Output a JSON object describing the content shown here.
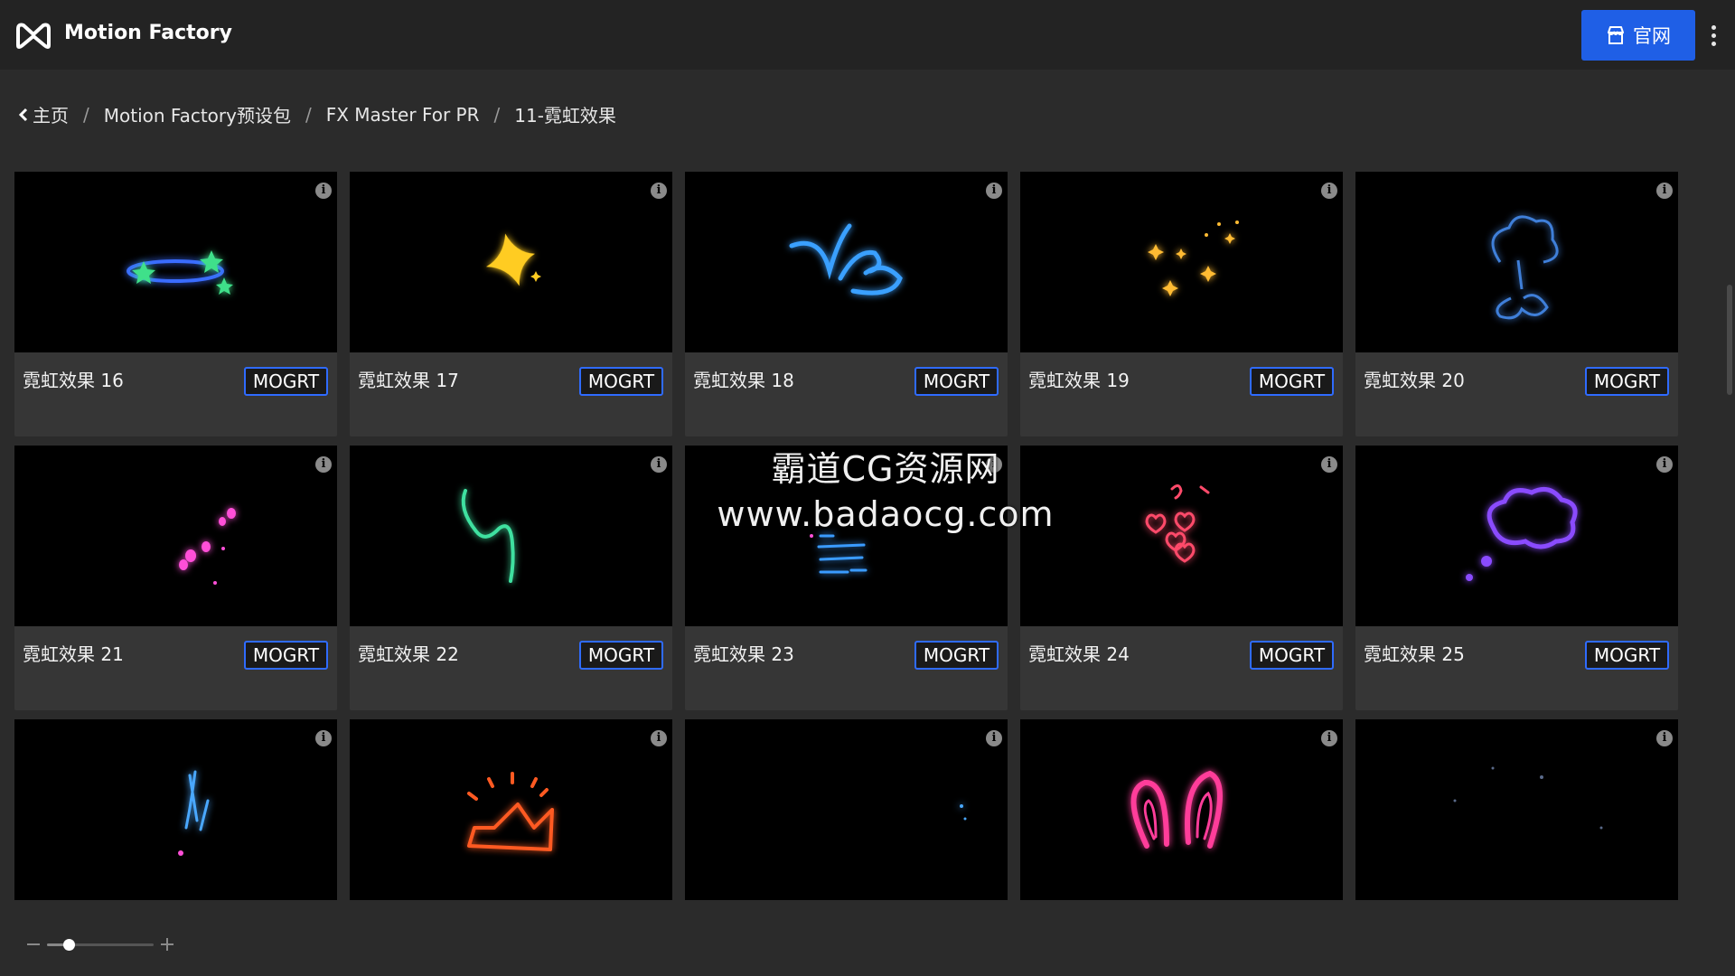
{
  "app": {
    "title": "Motion Factory",
    "site_button_label": "官网"
  },
  "breadcrumb": [
    "主页",
    "Motion Factory预设包",
    "FX Master For PR",
    "11-霓虹效果"
  ],
  "cards": [
    {
      "name": "霓虹效果 16",
      "tag": "MOGRT",
      "art": "neon-ring-stars-icon",
      "color": "#3a6cff"
    },
    {
      "name": "霓虹效果 17",
      "tag": "MOGRT",
      "art": "neon-star-icon",
      "color": "#ffcc22"
    },
    {
      "name": "霓虹效果 18",
      "tag": "MOGRT",
      "art": "neon-swirl-icon",
      "color": "#3aa0ff"
    },
    {
      "name": "霓虹效果 19",
      "tag": "MOGRT",
      "art": "neon-sparkles-icon",
      "color": "#ffbb33"
    },
    {
      "name": "霓虹效果 20",
      "tag": "MOGRT",
      "art": "neon-cloud-burst-icon",
      "color": "#3f7fd9"
    },
    {
      "name": "霓虹效果 21",
      "tag": "MOGRT",
      "art": "neon-dots-icon",
      "color": "#ff4fd8"
    },
    {
      "name": "霓虹效果 22",
      "tag": "MOGRT",
      "art": "neon-squiggle-icon",
      "color": "#3fe0a0"
    },
    {
      "name": "霓虹效果 23",
      "tag": "MOGRT",
      "art": "neon-speed-lines-icon",
      "color": "#3a9bff"
    },
    {
      "name": "霓虹效果 24",
      "tag": "MOGRT",
      "art": "neon-hearts-icon",
      "color": "#ff4a6a"
    },
    {
      "name": "霓虹效果 25",
      "tag": "MOGRT",
      "art": "neon-thought-bubble-icon",
      "color": "#8a4bff"
    },
    {
      "name": "",
      "tag": "",
      "art": "neon-exclamation-icon",
      "color": "#4aa8ff"
    },
    {
      "name": "",
      "tag": "",
      "art": "neon-crown-icon",
      "color": "#ff5a22"
    },
    {
      "name": "",
      "tag": "",
      "art": "neon-dot-icon",
      "color": "#4aa8ff"
    },
    {
      "name": "",
      "tag": "",
      "art": "neon-bunny-ears-icon",
      "color": "#ff3d9a"
    },
    {
      "name": "",
      "tag": "",
      "art": "neon-faint-dots-icon",
      "color": "#5a6a8a"
    }
  ],
  "watermark": {
    "line1": "霸道CG资源网",
    "line2": "www.badaocg.com"
  },
  "zoom": {
    "value": 0.2
  },
  "colors": {
    "accent": "#1f5fe6",
    "tag_border": "#2f6bff",
    "card_bg": "#363636",
    "page_bg": "#2b2b2b"
  }
}
